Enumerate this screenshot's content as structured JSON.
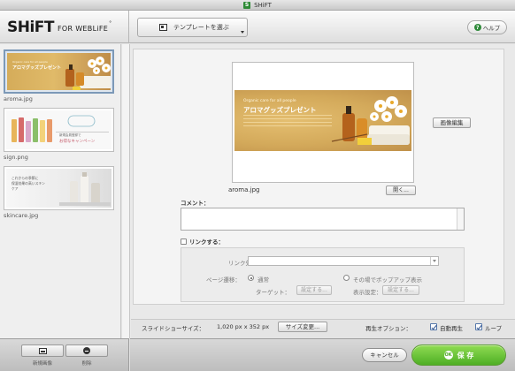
{
  "window": {
    "title": "SHiFT",
    "icon": "shift-app-icon"
  },
  "header": {
    "logo_main": "SHiFT",
    "logo_sub": "FOR WEBLiFE",
    "logo_mark": "°",
    "template_button": "テンプレートを選ぶ",
    "help_button": "ヘルプ",
    "help_icon_text": "?"
  },
  "sidebar": {
    "items": [
      {
        "filename": "aroma.jpg",
        "selected": true,
        "thumb_title": "アロマグッズプレゼント",
        "thumb_small": "Organic care for all people"
      },
      {
        "filename": "sign.png",
        "selected": false,
        "thumb_title": "新規会員登録で",
        "thumb_small": "お得なキャンペーン"
      },
      {
        "filename": "skincare.jpg",
        "selected": false,
        "thumb_title": "これからの季節に",
        "thumb_small": "保湿効果の高いスキンケア"
      }
    ],
    "buttons": [
      {
        "label": "新規画像",
        "icon": "new-image-icon"
      },
      {
        "label": "削除",
        "icon": "minus-circle-icon"
      }
    ]
  },
  "preview": {
    "banner_small": "Organic care for all people",
    "banner_title": "アロマグッズプレゼント",
    "filename": "aroma.jpg",
    "open_button": "開く...",
    "edit_button": "画像編集"
  },
  "comment": {
    "label": "コメント：",
    "value": ""
  },
  "link": {
    "checkbox_label": "リンクする：",
    "checked": false,
    "target_label": "リンク先：",
    "target_value": "",
    "transition_label": "ページ遷移：",
    "option_normal": "通常",
    "option_popup": "その場でポップアップ表示",
    "selected_option": "通常",
    "target_sub_label": "ターゲット：",
    "target_set_button": "設定する...",
    "display_label": "表示設定：",
    "display_set_button": "設定する..."
  },
  "slideshow": {
    "size_label": "スライドショーサイズ：",
    "size_value": "1,020 px x 352 px",
    "size_change_button": "サイズ変更...",
    "playback_label": "再生オプション：",
    "autoplay_label": "自動再生",
    "autoplay_checked": true,
    "loop_label": "ループ",
    "loop_checked": true
  },
  "footer": {
    "cancel_button": "キャンセル",
    "save_button": "保 存",
    "save_icon_text": "OK"
  },
  "colors": {
    "accent_green": "#4eae24",
    "selection_blue": "#7c99b8",
    "banner_gold": "#d4aa5b"
  }
}
